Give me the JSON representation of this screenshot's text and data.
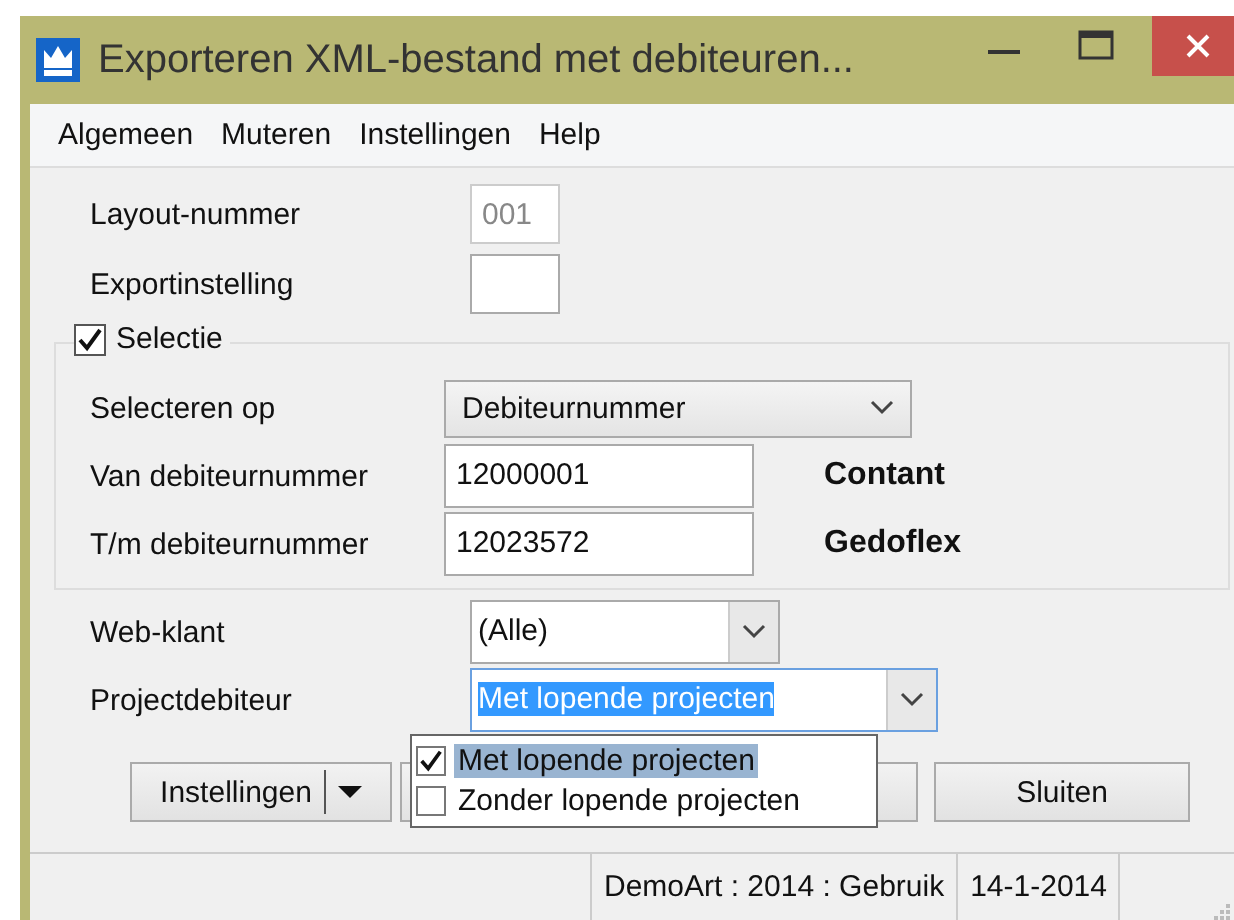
{
  "window": {
    "title": "Exporteren XML-bestand met debiteuren..."
  },
  "menu": [
    "Algemeen",
    "Muteren",
    "Instellingen",
    "Help"
  ],
  "top_fields": [
    {
      "label": "Layout-nummer",
      "value": "001",
      "disabled": true
    },
    {
      "label": "Exportinstelling",
      "disabled": false
    }
  ],
  "selection_group": {
    "label": "Selectie",
    "checked": true,
    "rows": [
      {
        "kind": "dropdown",
        "label": "Selecteren op",
        "value": "Debiteurnummer"
      },
      {
        "kind": "text",
        "label": "Van debiteurnummer",
        "value": "12000001",
        "note": "Contant"
      },
      {
        "kind": "text",
        "label": "T/m debiteurnummer",
        "value": "12023572",
        "note": "Gedoflex"
      }
    ]
  },
  "web_klant": {
    "label": "Web-klant",
    "value": "(Alle)"
  },
  "projectdebiteur": {
    "label": "Projectdebiteur",
    "value": "Met lopende projecten",
    "expanded": true,
    "options": [
      {
        "label": "Met lopende projecten",
        "checked": true,
        "selected": true
      },
      {
        "label": "Zonder lopende projecten",
        "checked": false,
        "selected": false
      }
    ]
  },
  "buttons": {
    "settings": "Instellingen",
    "close": "Sluiten"
  },
  "status_bar": [
    "DemoArt : 2014 : Gebruik",
    "14-1-2014"
  ]
}
